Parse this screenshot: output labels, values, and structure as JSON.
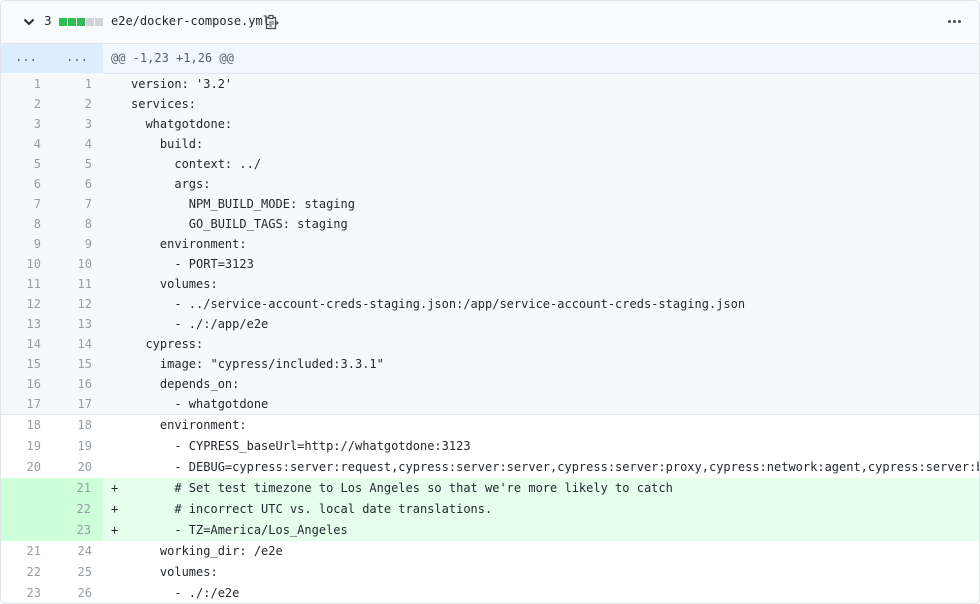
{
  "header": {
    "changed_count": "3",
    "diffstat_colors": [
      "#2cbe4e",
      "#2cbe4e",
      "#2cbe4e",
      "#d1d5da",
      "#d1d5da"
    ],
    "file_name": "e2e/docker-compose.yml",
    "collapse_icon": "chevron-down-icon",
    "copy_icon": "clipboard-icon",
    "menu_icon": "kebab-horizontal-icon"
  },
  "hunk": {
    "expand_left": "...",
    "expand_right": "...",
    "header": "@@ -1,23 +1,26 @@"
  },
  "lines": [
    {
      "old": "1",
      "new": "1",
      "marker": "",
      "code": "version: '3.2'",
      "kind": "expanded"
    },
    {
      "old": "2",
      "new": "2",
      "marker": "",
      "code": "services:",
      "kind": "expanded"
    },
    {
      "old": "3",
      "new": "3",
      "marker": "",
      "code": "  whatgotdone:",
      "kind": "expanded"
    },
    {
      "old": "4",
      "new": "4",
      "marker": "",
      "code": "    build:",
      "kind": "expanded"
    },
    {
      "old": "5",
      "new": "5",
      "marker": "",
      "code": "      context: ../",
      "kind": "expanded"
    },
    {
      "old": "6",
      "new": "6",
      "marker": "",
      "code": "      args:",
      "kind": "expanded"
    },
    {
      "old": "7",
      "new": "7",
      "marker": "",
      "code": "        NPM_BUILD_MODE: staging",
      "kind": "expanded"
    },
    {
      "old": "8",
      "new": "8",
      "marker": "",
      "code": "        GO_BUILD_TAGS: staging",
      "kind": "expanded"
    },
    {
      "old": "9",
      "new": "9",
      "marker": "",
      "code": "    environment:",
      "kind": "expanded"
    },
    {
      "old": "10",
      "new": "10",
      "marker": "",
      "code": "      - PORT=3123",
      "kind": "expanded"
    },
    {
      "old": "11",
      "new": "11",
      "marker": "",
      "code": "    volumes:",
      "kind": "expanded"
    },
    {
      "old": "12",
      "new": "12",
      "marker": "",
      "code": "      - ../service-account-creds-staging.json:/app/service-account-creds-staging.json",
      "kind": "expanded"
    },
    {
      "old": "13",
      "new": "13",
      "marker": "",
      "code": "      - ./:/app/e2e",
      "kind": "expanded"
    },
    {
      "old": "14",
      "new": "14",
      "marker": "",
      "code": "  cypress:",
      "kind": "expanded"
    },
    {
      "old": "15",
      "new": "15",
      "marker": "",
      "code": "    image: \"cypress/included:3.3.1\"",
      "kind": "expanded"
    },
    {
      "old": "16",
      "new": "16",
      "marker": "",
      "code": "    depends_on:",
      "kind": "expanded"
    },
    {
      "old": "17",
      "new": "17",
      "marker": "",
      "code": "      - whatgotdone",
      "kind": "expanded"
    },
    {
      "old": "18",
      "new": "18",
      "marker": "",
      "code": "    environment:",
      "kind": "normal"
    },
    {
      "old": "19",
      "new": "19",
      "marker": "",
      "code": "      - CYPRESS_baseUrl=http://whatgotdone:3123",
      "kind": "normal"
    },
    {
      "old": "20",
      "new": "20",
      "marker": "",
      "code": "      - DEBUG=cypress:server:request,cypress:server:server,cypress:server:proxy,cypress:network:agent,cypress:server:browsers",
      "kind": "normal"
    },
    {
      "old": "",
      "new": "21",
      "marker": "+",
      "code": "      # Set test timezone to Los Angeles so that we're more likely to catch",
      "kind": "add"
    },
    {
      "old": "",
      "new": "22",
      "marker": "+",
      "code": "      # incorrect UTC vs. local date translations.",
      "kind": "add"
    },
    {
      "old": "",
      "new": "23",
      "marker": "+",
      "code": "      - TZ=America/Los_Angeles",
      "kind": "add"
    },
    {
      "old": "21",
      "new": "24",
      "marker": "",
      "code": "    working_dir: /e2e",
      "kind": "normal"
    },
    {
      "old": "22",
      "new": "25",
      "marker": "",
      "code": "    volumes:",
      "kind": "normal"
    },
    {
      "old": "23",
      "new": "26",
      "marker": "",
      "code": "      - ./:/e2e",
      "kind": "normal"
    }
  ]
}
